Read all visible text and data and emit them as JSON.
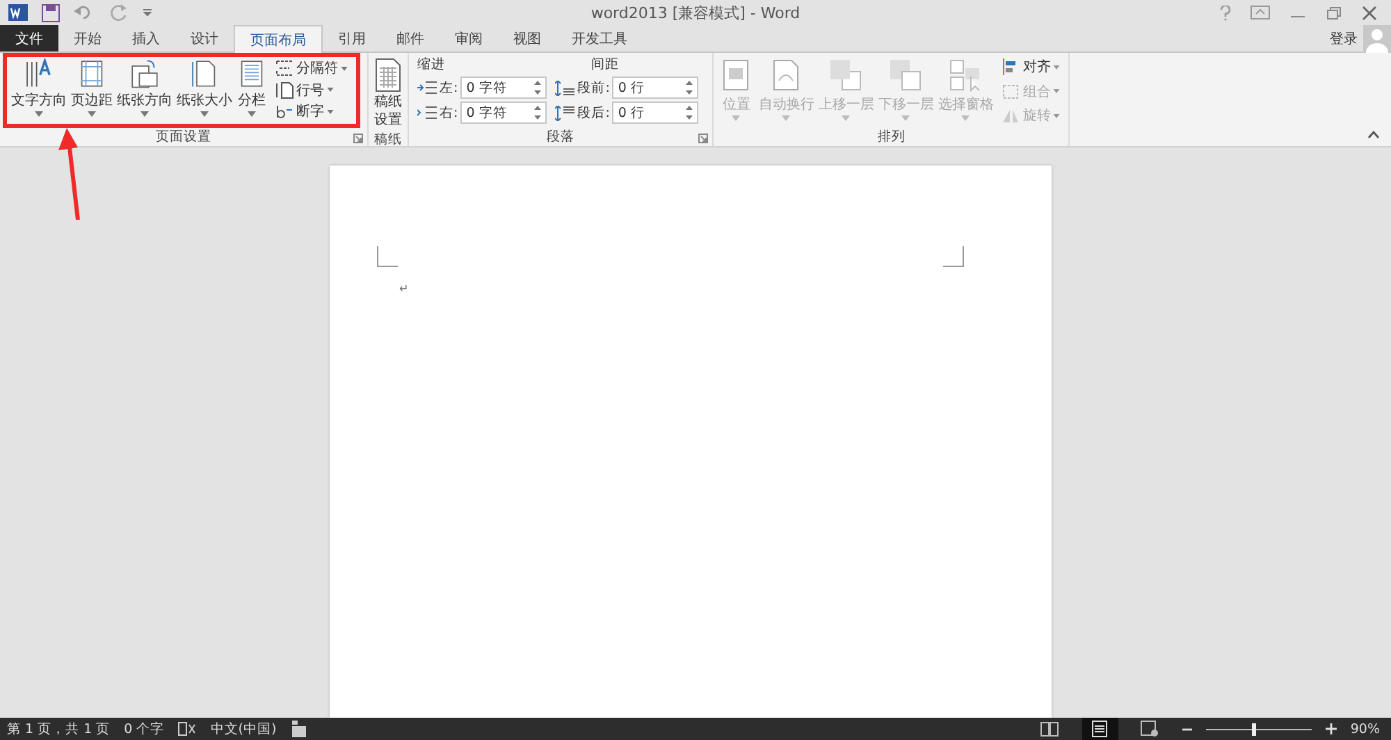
{
  "window": {
    "title": "word2013 [兼容模式] - Word"
  },
  "tabs": [
    {
      "label": "文件",
      "kind": "file",
      "selected": false
    },
    {
      "label": "开始",
      "kind": "tab",
      "selected": false
    },
    {
      "label": "插入",
      "kind": "tab",
      "selected": false
    },
    {
      "label": "设计",
      "kind": "tab",
      "selected": false
    },
    {
      "label": "页面布局",
      "kind": "tab",
      "selected": true
    },
    {
      "label": "引用",
      "kind": "tab",
      "selected": false
    },
    {
      "label": "邮件",
      "kind": "tab",
      "selected": false
    },
    {
      "label": "审阅",
      "kind": "tab",
      "selected": false
    },
    {
      "label": "视图",
      "kind": "tab",
      "selected": false
    },
    {
      "label": "开发工具",
      "kind": "tab",
      "selected": false
    }
  ],
  "account": {
    "sign_in": "登录"
  },
  "page_setup": {
    "label": "页面设置",
    "large_buttons": [
      {
        "label": "文字方向",
        "kind": "text-direction",
        "disabled": false
      },
      {
        "label": "页边距",
        "kind": "margins",
        "disabled": false
      },
      {
        "label": "纸张方向",
        "kind": "orientation",
        "disabled": false
      },
      {
        "label": "纸张大小",
        "kind": "size",
        "disabled": false
      },
      {
        "label": "分栏",
        "kind": "columns",
        "disabled": false
      }
    ],
    "small_buttons": [
      {
        "label": "分隔符",
        "kind": "breaks",
        "disabled": false
      },
      {
        "label": "行号",
        "kind": "line-numbers",
        "disabled": false
      },
      {
        "label": "断字",
        "kind": "hyphenation",
        "disabled": false
      }
    ]
  },
  "manuscript": {
    "label": "稿纸",
    "button": "稿纸设置"
  },
  "paragraph": {
    "label": "段落",
    "indent_label": "缩进",
    "spacing_label": "间距",
    "indent": [
      {
        "label": "左:",
        "value": "0 字符",
        "kind": "left"
      },
      {
        "label": "右:",
        "value": "0 字符",
        "kind": "right"
      }
    ],
    "spacing": [
      {
        "label": "段前:",
        "value": "0 行",
        "kind": "before"
      },
      {
        "label": "段后:",
        "value": "0 行",
        "kind": "after"
      }
    ]
  },
  "arrange": {
    "label": "排列",
    "large_buttons": [
      {
        "label": "位置",
        "kind": "position",
        "disabled": true
      },
      {
        "label": "自动换行",
        "kind": "wrap",
        "disabled": true
      },
      {
        "label": "上移一层",
        "kind": "forward",
        "disabled": true
      },
      {
        "label": "下移一层",
        "kind": "backward",
        "disabled": true
      },
      {
        "label": "选择窗格",
        "kind": "pane",
        "disabled": true
      }
    ],
    "small_buttons": [
      {
        "label": "对齐",
        "kind": "align",
        "disabled": false
      },
      {
        "label": "组合",
        "kind": "group",
        "disabled": true
      },
      {
        "label": "旋转",
        "kind": "rotate",
        "disabled": true
      }
    ]
  },
  "document": {
    "paragraph_mark": "↵"
  },
  "status_bar": {
    "page": "第 1 页，共 1 页",
    "words": "0 个字",
    "language": "中文(中国)",
    "views": [
      {
        "kind": "read",
        "selected": false
      },
      {
        "kind": "print",
        "selected": true
      },
      {
        "kind": "web",
        "selected": false
      }
    ],
    "zoom": {
      "level": 0.45,
      "reading": "90%"
    }
  }
}
